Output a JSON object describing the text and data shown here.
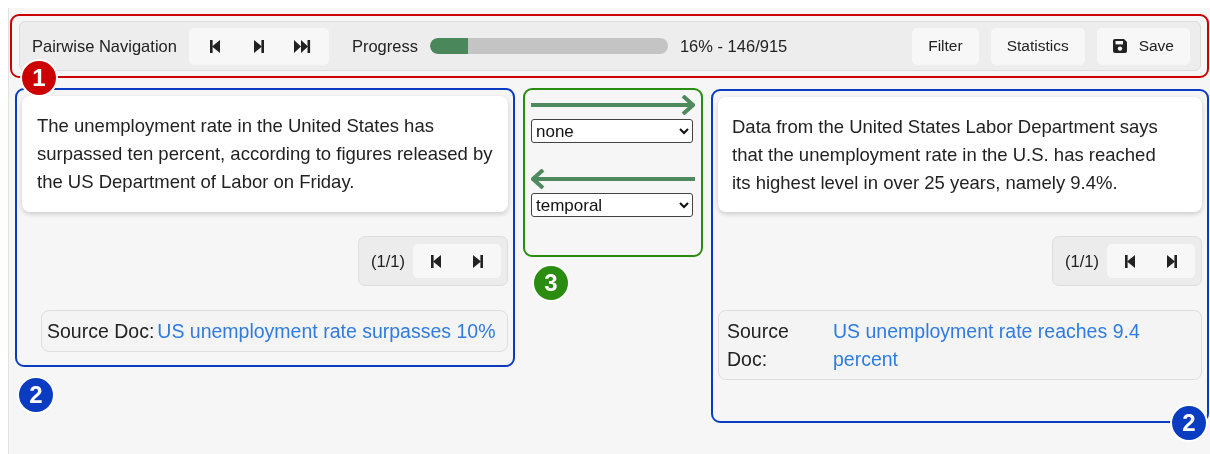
{
  "toolbar": {
    "annotation": {
      "label": "1",
      "color": "#cc0000"
    },
    "navigation_label": "Pairwise Navigation",
    "navigation_buttons": [
      {
        "kind": "first"
      },
      {
        "kind": "next"
      },
      {
        "kind": "last"
      }
    ],
    "progress_label": "Progress",
    "progress": {
      "level": 0.16,
      "reading": "16% - 146/915"
    },
    "buttons": [
      {
        "label": "Filter",
        "kind": "plain"
      },
      {
        "label": "Statistics",
        "kind": "plain"
      },
      {
        "label": "Save",
        "kind": "save"
      }
    ]
  },
  "documents": [
    {
      "annotation": {
        "label": "2",
        "color": "#0a3cc2"
      },
      "text": "The unemployment rate in the United States has surpassed ten percent, according to figures released by the US Department of Labor on Friday.",
      "pager": "(1/1)",
      "source_label": "Source Doc:",
      "source_link": "US unemployment rate surpasses 10%"
    },
    {
      "annotation": {
        "label": "2",
        "color": "#0a3cc2"
      },
      "text": "Data from the United States Labor Department says that the unemployment rate in the U.S. has reached its highest level in over 25 years, namely 9.4%.",
      "pager": "(1/1)",
      "source_label": "Source Doc:",
      "source_link": "US unemployment rate reaches 9.4 percent"
    }
  ],
  "relations": {
    "annotation": {
      "label": "3",
      "color": "#2a8c10"
    },
    "items": [
      {
        "kind": "forward",
        "value": "none"
      },
      {
        "kind": "backward",
        "value": "temporal"
      }
    ]
  }
}
